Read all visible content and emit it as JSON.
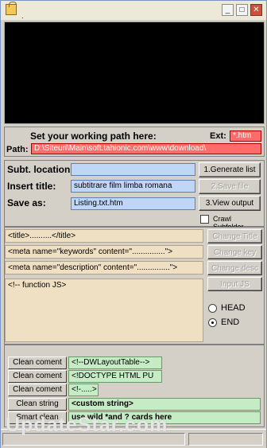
{
  "window": {
    "title_extra": "."
  },
  "path_panel": {
    "heading": "Set your working path here:",
    "ext_label": "Ext:",
    "ext_value": "*.htm",
    "path_label": "Path:",
    "path_value": "D:\\Siteuri\\Main\\soft.tahionic.com\\www\\download\\"
  },
  "controls": {
    "subt_location_label": "Subt. location",
    "subt_location_value": "",
    "insert_title_label": "Insert title:",
    "insert_title_value": "subtitrare film limba romana",
    "save_as_label": "Save as:",
    "save_as_value": "Listing.txt.htm",
    "generate_label": "1.Generate list",
    "save_file_label": "2.Save file",
    "view_output_label": "3.View output",
    "crawl_label": "Crawl Subfolder",
    "crawl_checked": false
  },
  "templates": {
    "title_tag": "<title>..........</title>",
    "meta_keywords": "<meta name=\"keywords\" content=\"...............\">",
    "meta_description": "<meta name=\"description\" content=\"...............\">",
    "function_js": "<!-- function JS>",
    "change_title_label": "Change Title",
    "change_key_label": "Change key",
    "change_desc_label": "Change desc",
    "input_js_label": "Input JS",
    "position_options": [
      "HEAD",
      "END"
    ],
    "position_selected": "END"
  },
  "clean": {
    "rows": [
      {
        "button": "Clean coment",
        "value": "<!--DWLayoutTable-->"
      },
      {
        "button": "Clean coment",
        "value": "<!DOCTYPE HTML PU"
      },
      {
        "button": "Clean coment",
        "value": "<!-.....>"
      },
      {
        "button": "Clean string",
        "value": "<custom string>"
      },
      {
        "button": "Smart clean",
        "value": "use wild *and ? cards here"
      }
    ]
  },
  "watermark": "UpdateStar.com",
  "colors": {
    "path_bg": "#ff6b6b",
    "input_bg": "#bfd6f6",
    "template_bg": "#efdfc3",
    "clean_bg": "#c5ecc5"
  }
}
